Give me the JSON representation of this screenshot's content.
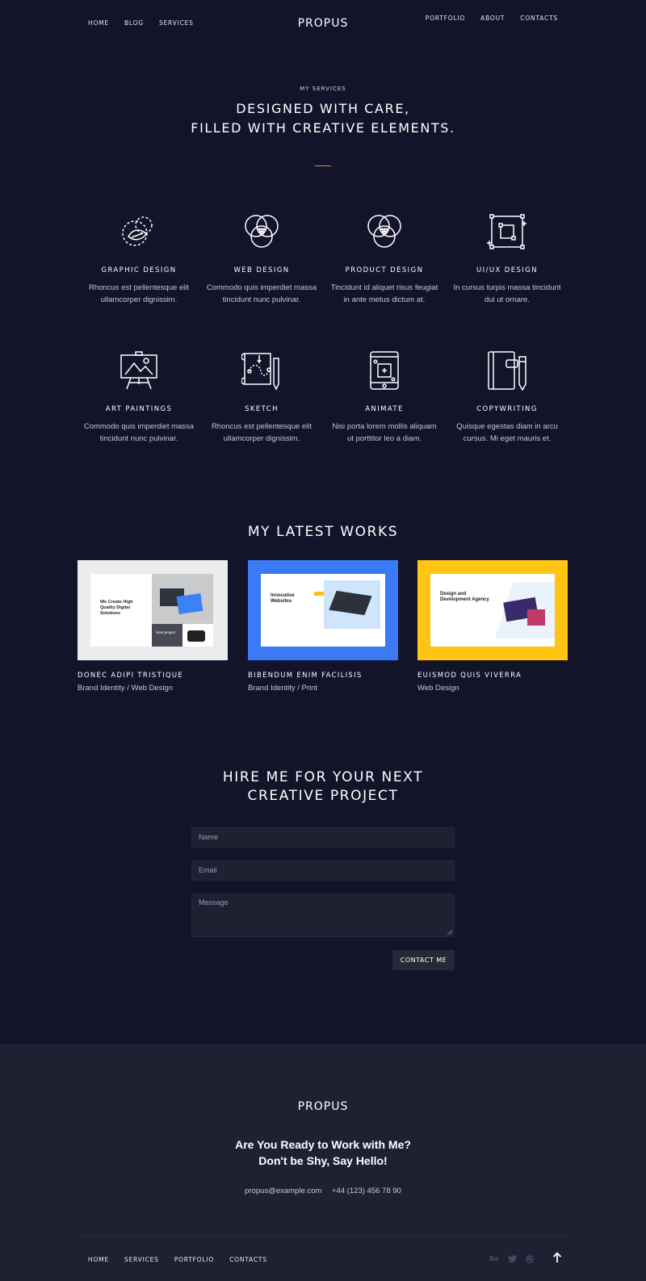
{
  "header": {
    "nav_left": [
      "HOME",
      "BLOG",
      "SERVICES"
    ],
    "logo": "PROPUS",
    "nav_right": [
      "PORTFOLIO",
      "ABOUT",
      "CONTACTS"
    ]
  },
  "services_section": {
    "kicker": "MY SERVICES",
    "title_line1": "DESIGNED WITH CARE,",
    "title_line2": "FILLED WITH CREATIVE ELEMENTS.",
    "items": [
      {
        "icon": "graphic-design-icon",
        "title": "GRAPHIC DESIGN",
        "desc1": "Rhoncus est pellentesque elit",
        "desc2": "ullamcorper dignissim."
      },
      {
        "icon": "web-design-icon",
        "title": "WEB DESIGN",
        "desc1": "Commodo quis imperdiet massa",
        "desc2": "tincidunt nunc pulvinar."
      },
      {
        "icon": "product-design-icon",
        "title": "PRODUCT DESIGN",
        "desc1": "Tincidunt id aliquet risus feugiat",
        "desc2": "in ante metus dictum at."
      },
      {
        "icon": "ui-ux-design-icon",
        "title": "UI/UX DESIGN",
        "desc1": "In cursus turpis massa tincidunt",
        "desc2": "dui ut ornare."
      },
      {
        "icon": "art-paintings-icon",
        "title": "ART PAINTINGS",
        "desc1": "Commodo quis imperdiet massa",
        "desc2": "tincidunt nunc pulvinar."
      },
      {
        "icon": "sketch-icon",
        "title": "SKETCH",
        "desc1": "Rhoncus est pellentesque elit",
        "desc2": "ullamcorper dignissim."
      },
      {
        "icon": "animate-icon",
        "title": "ANIMATE",
        "desc1": "Nisi porta lorem mollis aliquam",
        "desc2": "ut porttitor leo a diam."
      },
      {
        "icon": "copywriting-icon",
        "title": "COPYWRITING",
        "desc1": "Quisque egestas diam in arcu",
        "desc2": "cursus. Mi eget mauris et."
      }
    ]
  },
  "works_section": {
    "title": "MY LATEST WORKS",
    "items": [
      {
        "title": "DONEC ADIPI TRISTIQUE",
        "category": "Brand Identity / Web Design",
        "bg": "#ececee",
        "thumb_heading": "We Create High Quality Digital Solutions",
        "thumb_sub": "Next project"
      },
      {
        "title": "BIBENDUM ENIM FACILISIS",
        "category": "Brand Identity / Print",
        "bg": "#3a7bf5",
        "thumb_heading": "Innovative Websites",
        "thumb_sub": ""
      },
      {
        "title": "EUISMOD QUIS VIVERRA",
        "category": "Web Design",
        "bg": "#ffc414",
        "thumb_heading": "Design and Development Agency",
        "thumb_sub": ""
      }
    ]
  },
  "hire_section": {
    "title_line1": "HIRE ME FOR YOUR NEXT",
    "title_line2": "CREATIVE PROJECT",
    "name_placeholder": "Name",
    "email_placeholder": "Email",
    "message_placeholder": "Message",
    "submit_label": "CONTACT ME"
  },
  "footer": {
    "logo": "PROPUS",
    "cta_line1": "Are You Ready to Work with Me?",
    "cta_line2": "Don't be Shy, Say Hello!",
    "email": "propus@example.com",
    "phone": "+44 (123) 456 78 90",
    "nav": [
      "HOME",
      "SERVICES",
      "PORTFOLIO",
      "CONTACTS"
    ],
    "social": [
      "Be",
      "twitter-icon",
      "dribbble-icon"
    ],
    "colors": {
      "accent": "#c79a55",
      "bg_dark": "#13132a",
      "bg_footer": "#1f2133"
    }
  }
}
